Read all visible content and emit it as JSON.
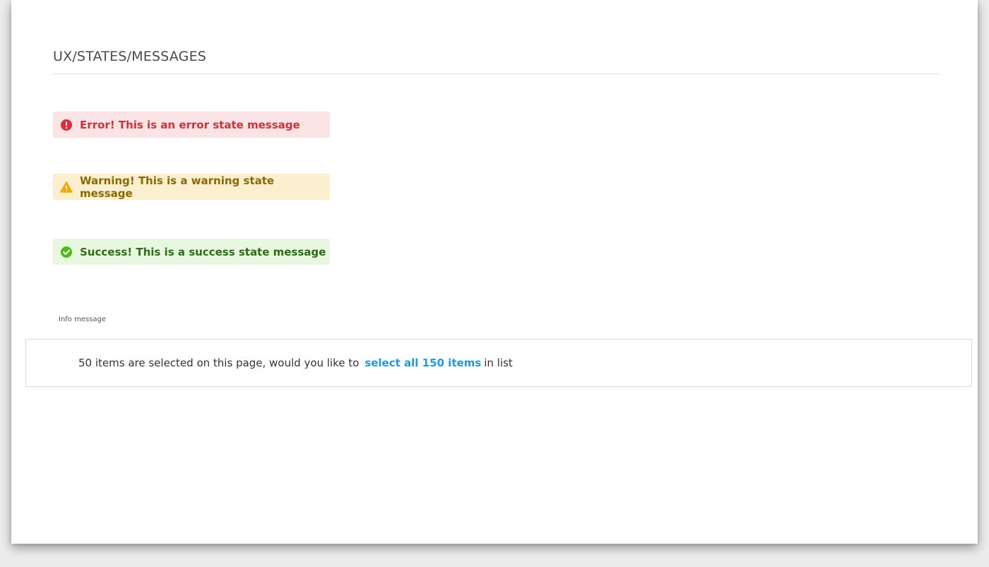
{
  "page": {
    "title": "UX/STATES/MESSAGES"
  },
  "messages": {
    "error": {
      "text": "Error! This is an error state message",
      "icon": "error-circle-icon",
      "color": "#d32f3a",
      "background": "#fbe4e6"
    },
    "warning": {
      "text": "Warning! This is a warning state message",
      "icon": "warning-triangle-icon",
      "color": "#8a6a05",
      "background": "#fcefcf"
    },
    "success": {
      "text": "Success! This is a success state message",
      "icon": "check-circle-icon",
      "color": "#2f6b1a",
      "background": "#e8f7e0"
    }
  },
  "info": {
    "label": "Info message",
    "text_before": "50 items are selected on this page,  would you like to",
    "link_text": "select all 150 items",
    "text_after": "in list",
    "link_color": "#1b9be0"
  }
}
